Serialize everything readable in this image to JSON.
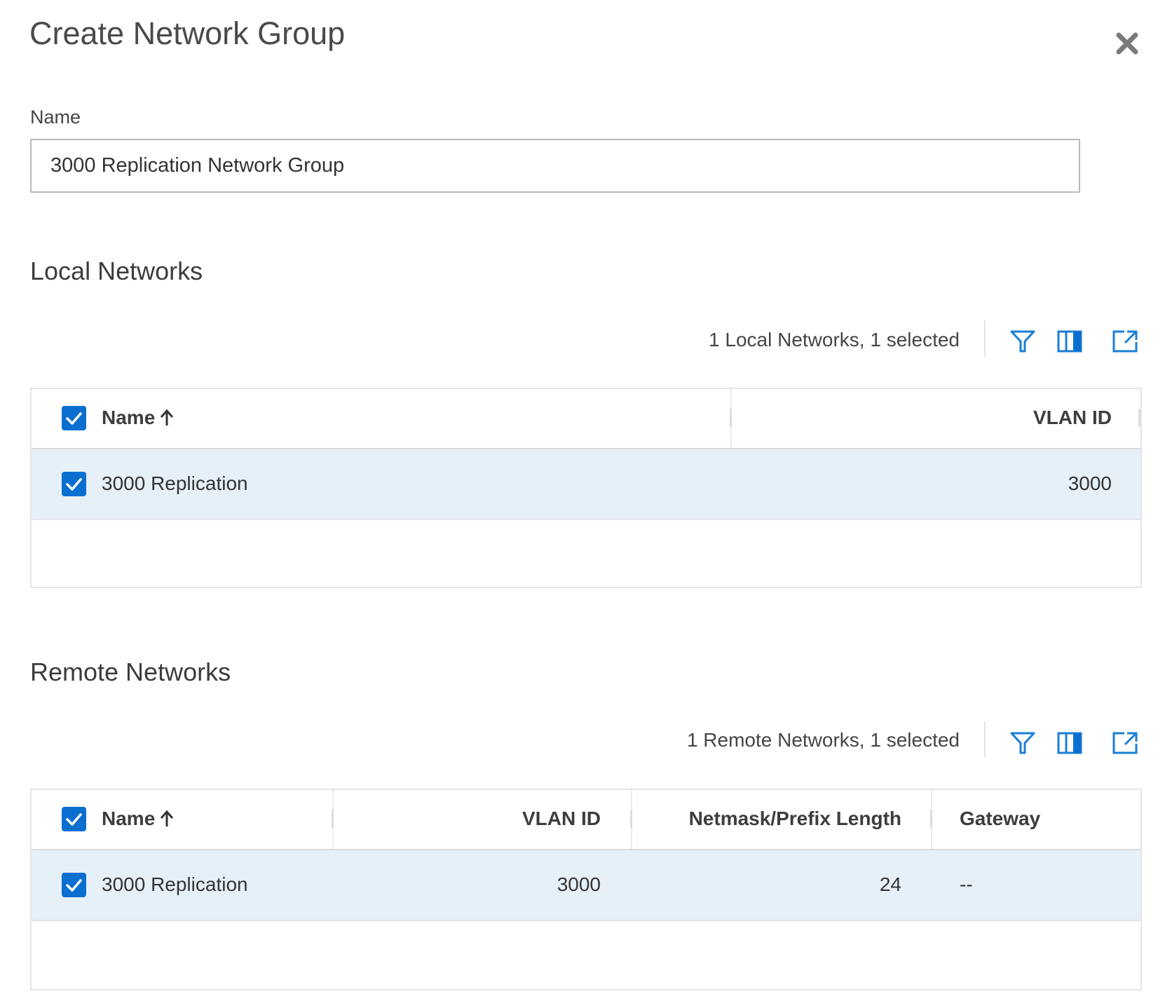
{
  "dialog": {
    "title": "Create Network Group",
    "close_icon": "close-icon"
  },
  "name_field": {
    "label": "Name",
    "value": "3000 Replication Network Group",
    "placeholder": ""
  },
  "local_networks": {
    "section_title": "Local Networks",
    "summary": "1 Local Networks, 1 selected",
    "toolbar_icons": [
      "filter-icon",
      "columns-icon",
      "export-icon"
    ],
    "columns": [
      {
        "label": "Name",
        "sort": "ascending"
      },
      {
        "label": "VLAN ID"
      }
    ],
    "rows": [
      {
        "selected": true,
        "name": "3000 Replication",
        "vlan_id": "3000"
      }
    ],
    "select_all": true
  },
  "remote_networks": {
    "section_title": "Remote Networks",
    "summary": "1 Remote Networks, 1 selected",
    "toolbar_icons": [
      "filter-icon",
      "columns-icon",
      "export-icon"
    ],
    "columns": [
      {
        "label": "Name",
        "sort": "ascending"
      },
      {
        "label": "VLAN ID"
      },
      {
        "label": "Netmask/Prefix Length"
      },
      {
        "label": "Gateway"
      }
    ],
    "rows": [
      {
        "selected": true,
        "name": "3000 Replication",
        "vlan_id": "3000",
        "prefix_length": "24",
        "gateway": "--"
      }
    ],
    "select_all": true
  },
  "colors": {
    "accent": "#0b6fd0",
    "selected_row": "#e6f0f9",
    "border": "#e6e6e6"
  }
}
